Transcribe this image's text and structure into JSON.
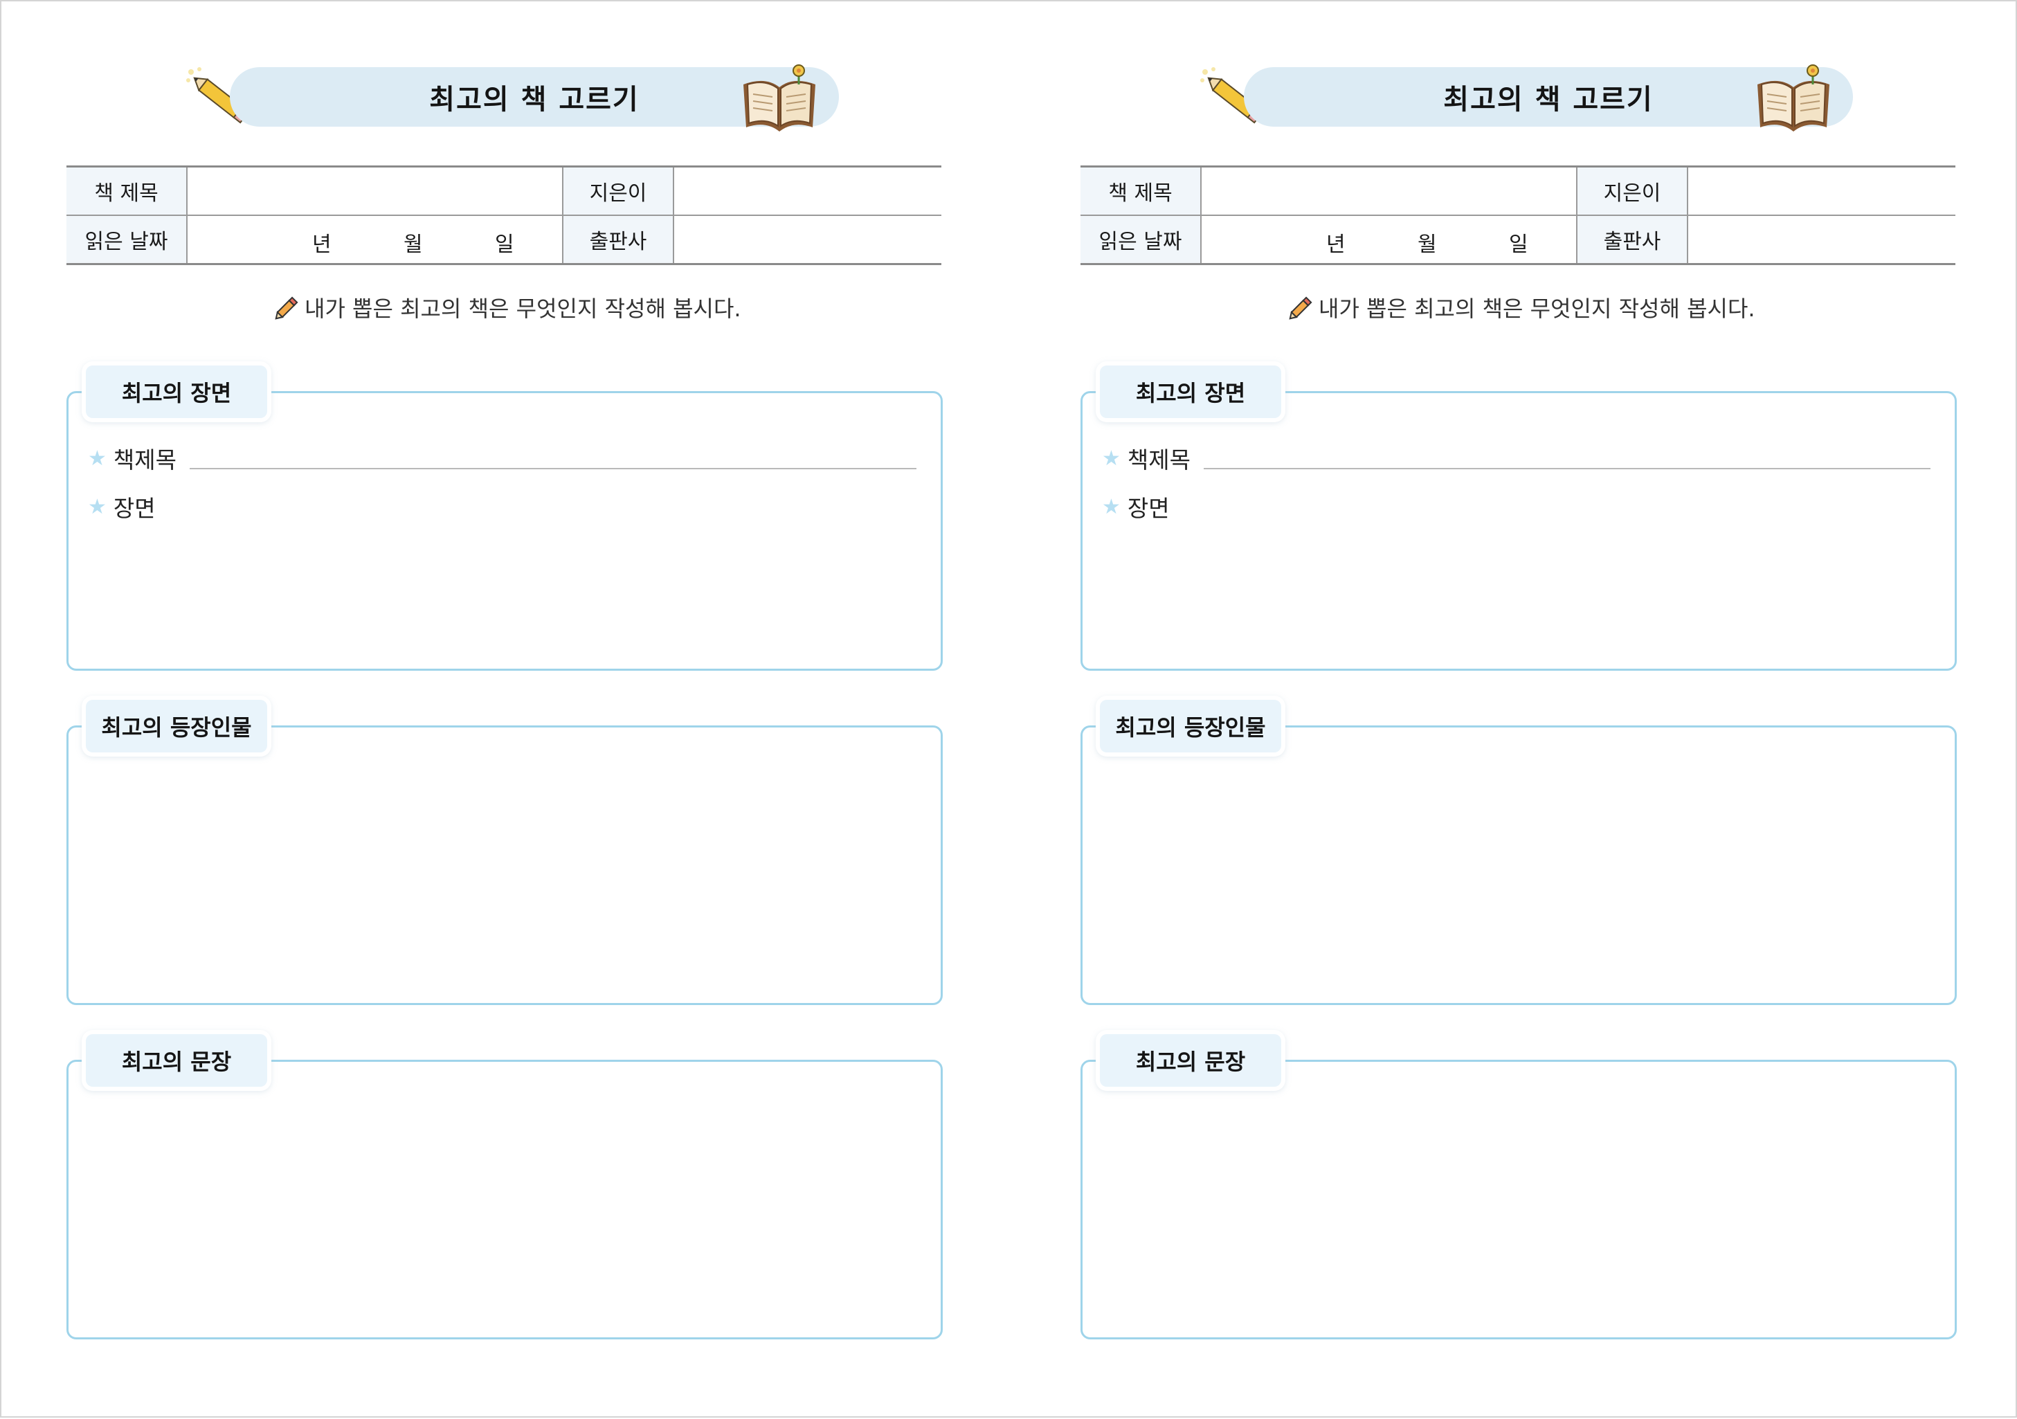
{
  "pages": [
    {
      "title": "최고의 책 고르기",
      "info": {
        "book_title_label": "책 제목",
        "author_label": "지은이",
        "read_date_label": "읽은 날짜",
        "year_unit": "년",
        "month_unit": "월",
        "day_unit": "일",
        "publisher_label": "출판사"
      },
      "instruction": "내가 뽑은 최고의 책은 무엇인지 작성해 봅시다.",
      "sections": [
        {
          "title": "최고의 장면",
          "rows": [
            "책제목",
            "장면"
          ]
        },
        {
          "title": "최고의 등장인물"
        },
        {
          "title": "최고의 문장"
        }
      ]
    },
    {
      "title": "최고의 책 고르기",
      "info": {
        "book_title_label": "책 제목",
        "author_label": "지은이",
        "read_date_label": "읽은 날짜",
        "year_unit": "년",
        "month_unit": "월",
        "day_unit": "일",
        "publisher_label": "출판사"
      },
      "instruction": "내가 뽑은 최고의 책은 무엇인지 작성해 봅시다.",
      "sections": [
        {
          "title": "최고의 장면",
          "rows": [
            "책제목",
            "장면"
          ]
        },
        {
          "title": "최고의 등장인물"
        },
        {
          "title": "최고의 문장"
        }
      ]
    }
  ],
  "icons": {
    "banner_left": "pencil-icon",
    "banner_right": "open-book-icon",
    "instruction": "pencil-icon",
    "bullet": "star-icon"
  },
  "colors": {
    "banner": "#dcebf4",
    "section_border": "#9fd4ea",
    "label_cell": "#f1f6fa",
    "star": "#b6dff2"
  }
}
